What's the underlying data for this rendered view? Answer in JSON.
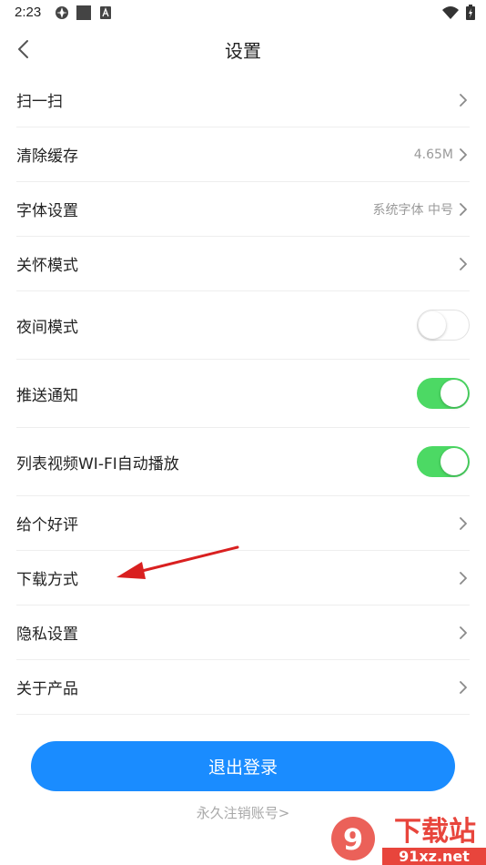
{
  "status_bar": {
    "time": "2:23"
  },
  "header": {
    "title": "设置"
  },
  "settings": {
    "scan": {
      "label": "扫一扫"
    },
    "clear_cache": {
      "label": "清除缓存",
      "value": "4.65M"
    },
    "font": {
      "label": "字体设置",
      "value": "系统字体 中号"
    },
    "care_mode": {
      "label": "关怀模式"
    },
    "night_mode": {
      "label": "夜间模式",
      "enabled": false
    },
    "push": {
      "label": "推送通知",
      "enabled": true
    },
    "autoplay": {
      "label": "列表视频WI-FI自动播放",
      "enabled": true
    },
    "rate": {
      "label": "给个好评"
    },
    "download": {
      "label": "下载方式"
    },
    "privacy": {
      "label": "隐私设置"
    },
    "about": {
      "label": "关于产品"
    }
  },
  "logout": {
    "label": "退出登录"
  },
  "cancel_account": {
    "label": "永久注销账号>"
  },
  "watermark": {
    "brand": "下载站",
    "domain": "91xz.net"
  },
  "colors": {
    "accent": "#1a8cff",
    "toggle_on": "#4cd964",
    "annotation_arrow": "#d92020"
  }
}
